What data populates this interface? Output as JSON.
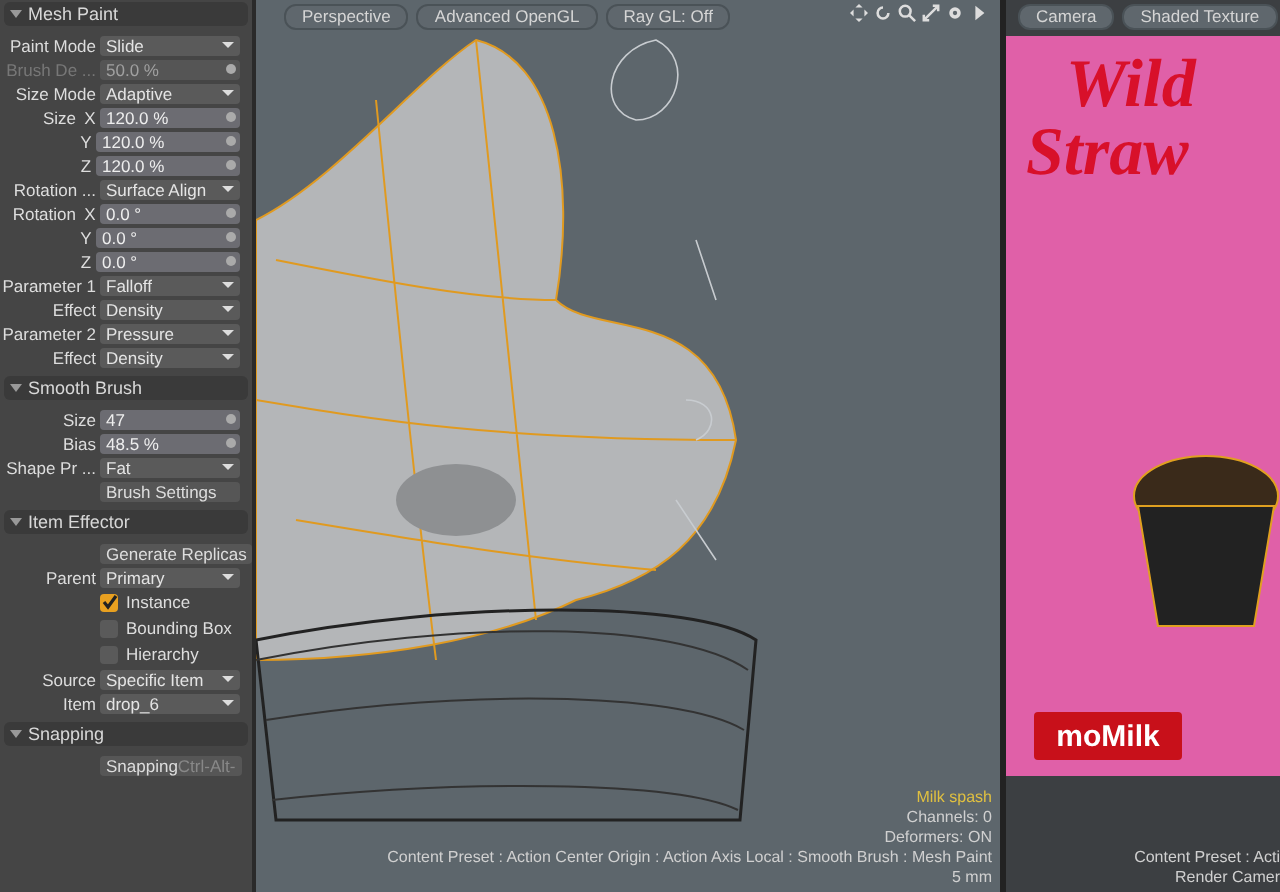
{
  "panel": {
    "sections": [
      {
        "title": "Mesh Paint",
        "expanded": true,
        "rows": [
          {
            "kind": "dropdown",
            "label": "Paint Mode",
            "value": "Slide"
          },
          {
            "kind": "number",
            "label": "Brush De ...",
            "value": "50.0 %",
            "disabled": true
          },
          {
            "kind": "dropdown",
            "label": "Size Mode",
            "value": "Adaptive"
          },
          {
            "kind": "number",
            "label": "Size",
            "axis": "X",
            "value": "120.0 %",
            "disabled": false
          },
          {
            "kind": "number",
            "axis": "Y",
            "value": "120.0 %",
            "disabled": false
          },
          {
            "kind": "number",
            "axis": "Z",
            "value": "120.0 %",
            "disabled": false
          },
          {
            "kind": "dropdown",
            "label": "Rotation ...",
            "value": "Surface Align"
          },
          {
            "kind": "number",
            "label": "Rotation",
            "axis": "X",
            "value": "0.0 °",
            "disabled": false
          },
          {
            "kind": "number",
            "axis": "Y",
            "value": "0.0 °",
            "disabled": false
          },
          {
            "kind": "number",
            "axis": "Z",
            "value": "0.0 °",
            "disabled": false
          },
          {
            "kind": "dropdown",
            "label": "Parameter 1",
            "value": "Falloff"
          },
          {
            "kind": "dropdown",
            "label": "Effect",
            "value": "Density"
          },
          {
            "kind": "dropdown",
            "label": "Parameter 2",
            "value": "Pressure"
          },
          {
            "kind": "dropdown",
            "label": "Effect",
            "value": "Density"
          }
        ]
      },
      {
        "title": "Smooth Brush",
        "expanded": true,
        "rows": [
          {
            "kind": "number",
            "label": "Size",
            "value": "47",
            "disabled": false
          },
          {
            "kind": "number",
            "label": "Bias",
            "value": "48.5 %",
            "disabled": false
          },
          {
            "kind": "dropdown",
            "label": "Shape Pr ...",
            "value": "Fat"
          },
          {
            "kind": "button",
            "value": "Brush Settings"
          }
        ]
      },
      {
        "title": "Item Effector",
        "expanded": true,
        "rows": [
          {
            "kind": "button",
            "value": "Generate Replicas"
          },
          {
            "kind": "dropdown",
            "label": "Parent",
            "value": "Primary"
          },
          {
            "kind": "checkbox",
            "value": "Instance",
            "checked": true
          },
          {
            "kind": "checkbox",
            "value": "Bounding Box",
            "checked": false
          },
          {
            "kind": "checkbox",
            "value": "Hierarchy",
            "checked": false
          },
          {
            "kind": "dropdown",
            "label": "Source",
            "value": "Specific Item"
          },
          {
            "kind": "dropdown",
            "label": "Item",
            "value": "drop_6"
          }
        ]
      },
      {
        "title": "Snapping",
        "expanded": true,
        "rows": [
          {
            "kind": "button",
            "value": "Snapping",
            "shortcut": "Ctrl-Alt-"
          }
        ]
      }
    ]
  },
  "viewport": {
    "tabs": [
      "Perspective",
      "Advanced OpenGL",
      "Ray GL: Off"
    ],
    "info": {
      "item": "Milk spash",
      "lines": [
        "Channels: 0",
        "Deformers: ON",
        "Content Preset : Action Center Origin : Action Axis Local : Smooth Brush : Mesh Paint",
        "5 mm"
      ]
    }
  },
  "render_view": {
    "tabs": [
      "Camera",
      "Shaded Texture"
    ],
    "poster": {
      "headline": [
        "Wild",
        "Straw"
      ],
      "brand": "moMilk"
    },
    "info_lines": [
      "Content Preset : Acti",
      "Render Camer"
    ]
  }
}
